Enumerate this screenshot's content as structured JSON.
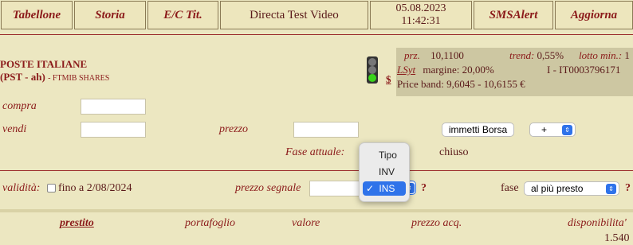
{
  "nav": {
    "tabellone": "Tabellone",
    "storia": "Storia",
    "ec_tit": "E/C Tit.",
    "title": "Directa Test Video",
    "date": "05.08.2023",
    "time": "11:42:31",
    "smsalert": "SMSAlert",
    "aggiorna": "Aggiorna"
  },
  "stock": {
    "name": "POSTE ITALIANE",
    "code": "(PST - ah)",
    "sub": "- FTMIB SHARES",
    "currency_symbol": "$"
  },
  "info": {
    "prz_label": "prz.",
    "prz_value": "10,1100",
    "trend_label": "trend:",
    "trend_value": "0,55%",
    "lotto_label": "lotto min.:",
    "lotto_value": "1",
    "lsyt": "LSyt",
    "margin_label": "margine:",
    "margin_value": "20,00%",
    "isin": "I - IT0003796171",
    "price_band": "Price band: 9,6045 - 10,6155 €"
  },
  "order": {
    "compra_label": "compra",
    "vendi_label": "vendi",
    "prezzo_label": "prezzo",
    "borsa_button": "immetti Borsa",
    "sign_select": "+",
    "fase_attuale_label": "Fase attuale:",
    "fase_attuale_value": "chiuso"
  },
  "popup": {
    "items": [
      "Tipo",
      "INV",
      "INS"
    ],
    "selected": "INS",
    "check": "✓"
  },
  "validity": {
    "label": "validità:",
    "fino": "fino a 2/08/2024",
    "prezzo_segnale_label": "prezzo segnale",
    "question": "?",
    "fase_label": "fase",
    "fase_select": "al più presto"
  },
  "columns": {
    "prestito": "prestito",
    "portafoglio": "portafoglio",
    "valore": "valore",
    "prezzo_acq": "prezzo acq.",
    "disponibilita": "disponibilita'",
    "disponibilita_value": "1.540"
  },
  "colors": {
    "background": "#ece7c1",
    "accent": "#8b1a1a",
    "info_box": "#cdc7a2",
    "selection": "#2f73ea"
  }
}
